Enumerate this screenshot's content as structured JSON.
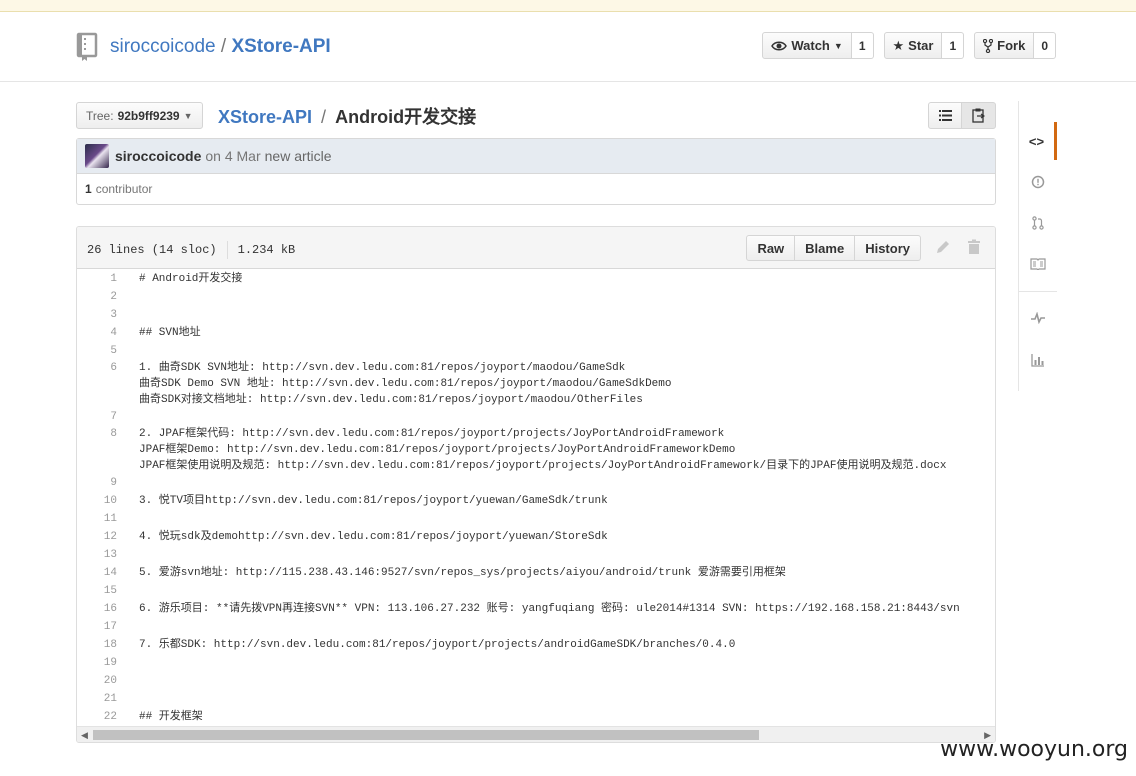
{
  "repo": {
    "owner": "siroccoicode",
    "separator": "/",
    "name": "XStore-API"
  },
  "actions": {
    "watch_label": "Watch",
    "watch_count": "1",
    "star_label": "Star",
    "star_count": "1",
    "fork_label": "Fork",
    "fork_count": "0"
  },
  "file_nav": {
    "tree_label": "Tree:",
    "tree_sha": "92b9ff9239",
    "breadcrumb_root": "XStore-API",
    "breadcrumb_sep": "/",
    "breadcrumb_file": "Android开发交接"
  },
  "commit": {
    "author": "siroccoicode",
    "date": "on 4 Mar",
    "message": "new article",
    "contributors_count": "1",
    "contributors_label": "contributor"
  },
  "file": {
    "lines_info": "26 lines (14 sloc)",
    "size": "1.234 kB",
    "raw_label": "Raw",
    "blame_label": "Blame",
    "history_label": "History"
  },
  "code_lines": [
    {
      "n": "1",
      "t": "# Android开发交接"
    },
    {
      "n": "2",
      "t": ""
    },
    {
      "n": "3",
      "t": ""
    },
    {
      "n": "4",
      "t": "## SVN地址"
    },
    {
      "n": "5",
      "t": ""
    },
    {
      "n": "6",
      "t": "1. 曲奇SDK SVN地址: http://svn.dev.ledu.com:81/repos/joyport/maodou/GameSdk"
    },
    {
      "n": "",
      "t": "曲奇SDK Demo SVN 地址: http://svn.dev.ledu.com:81/repos/joyport/maodou/GameSdkDemo"
    },
    {
      "n": "",
      "t": "曲奇SDK对接文档地址: http://svn.dev.ledu.com:81/repos/joyport/maodou/OtherFiles"
    },
    {
      "n": "7",
      "t": ""
    },
    {
      "n": "8",
      "t": "2. JPAF框架代码: http://svn.dev.ledu.com:81/repos/joyport/projects/JoyPortAndroidFramework"
    },
    {
      "n": "",
      "t": "JPAF框架Demo: http://svn.dev.ledu.com:81/repos/joyport/projects/JoyPortAndroidFrameworkDemo"
    },
    {
      "n": "",
      "t": "JPAF框架使用说明及规范: http://svn.dev.ledu.com:81/repos/joyport/projects/JoyPortAndroidFramework/目录下的JPAF使用说明及规范.docx"
    },
    {
      "n": "9",
      "t": ""
    },
    {
      "n": "10",
      "t": "3. 悦TV项目http://svn.dev.ledu.com:81/repos/joyport/yuewan/GameSdk/trunk"
    },
    {
      "n": "11",
      "t": ""
    },
    {
      "n": "12",
      "t": "4. 悦玩sdk及demohttp://svn.dev.ledu.com:81/repos/joyport/yuewan/StoreSdk"
    },
    {
      "n": "13",
      "t": ""
    },
    {
      "n": "14",
      "t": "5. 爱游svn地址: http://115.238.43.146:9527/svn/repos_sys/projects/aiyou/android/trunk 爱游需要引用框架"
    },
    {
      "n": "15",
      "t": ""
    },
    {
      "n": "16",
      "t": "6. 游乐项目: **请先拨VPN再连接SVN** VPN: 113.106.27.232 账号: yangfuqiang 密码: ule2014#1314 SVN: https://192.168.158.21:8443/svn"
    },
    {
      "n": "17",
      "t": ""
    },
    {
      "n": "18",
      "t": "7. 乐都SDK: http://svn.dev.ledu.com:81/repos/joyport/projects/androidGameSDK/branches/0.4.0"
    },
    {
      "n": "19",
      "t": ""
    },
    {
      "n": "20",
      "t": ""
    },
    {
      "n": "21",
      "t": ""
    },
    {
      "n": "22",
      "t": "## 开发框架"
    }
  ],
  "watermark": "www.wooyun.org"
}
